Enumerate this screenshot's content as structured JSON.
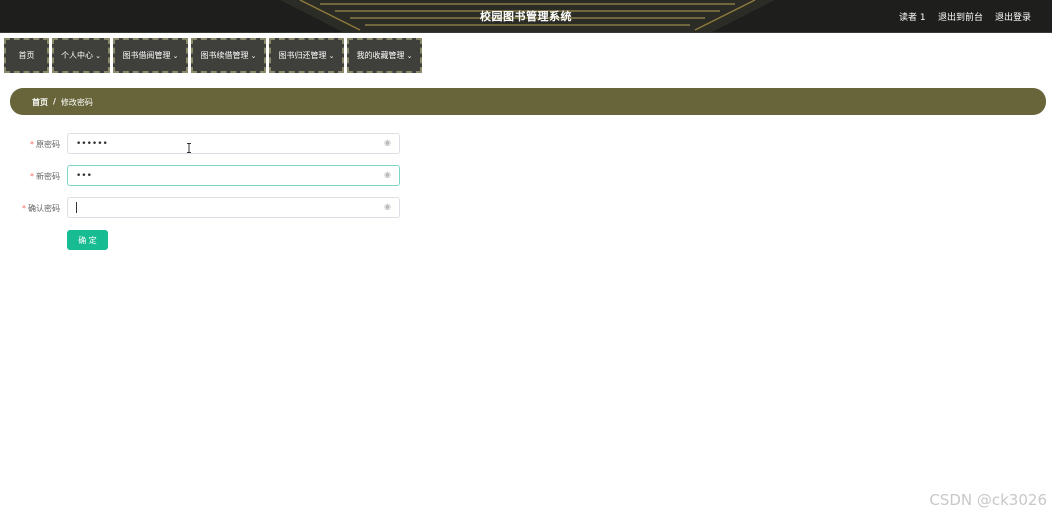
{
  "header": {
    "title": "校园图书管理系统",
    "user_label": "读者 1",
    "back_link": "退出到前台",
    "logout_link": "退出登录"
  },
  "menu": {
    "items": [
      {
        "label": "首页",
        "has_dropdown": false
      },
      {
        "label": "个人中心",
        "has_dropdown": true
      },
      {
        "label": "图书借阅管理",
        "has_dropdown": true
      },
      {
        "label": "图书续借管理",
        "has_dropdown": true
      },
      {
        "label": "图书归还管理",
        "has_dropdown": true
      },
      {
        "label": "我的收藏管理",
        "has_dropdown": true
      }
    ]
  },
  "breadcrumb": {
    "home": "首页",
    "separator": "/",
    "current": "修改密码"
  },
  "form": {
    "old_password": {
      "label": "原密码",
      "value": "••••••"
    },
    "new_password": {
      "label": "新密码",
      "value": "•••"
    },
    "confirm_password": {
      "label": "确认密码",
      "value": ""
    },
    "submit_label": "确 定"
  },
  "watermark": "CSDN @ck3026",
  "colors": {
    "topbar": "#1e1e1c",
    "breadcrumb_bar": "#676539",
    "submit": "#18bc93",
    "required_star": "#f56c6c"
  }
}
